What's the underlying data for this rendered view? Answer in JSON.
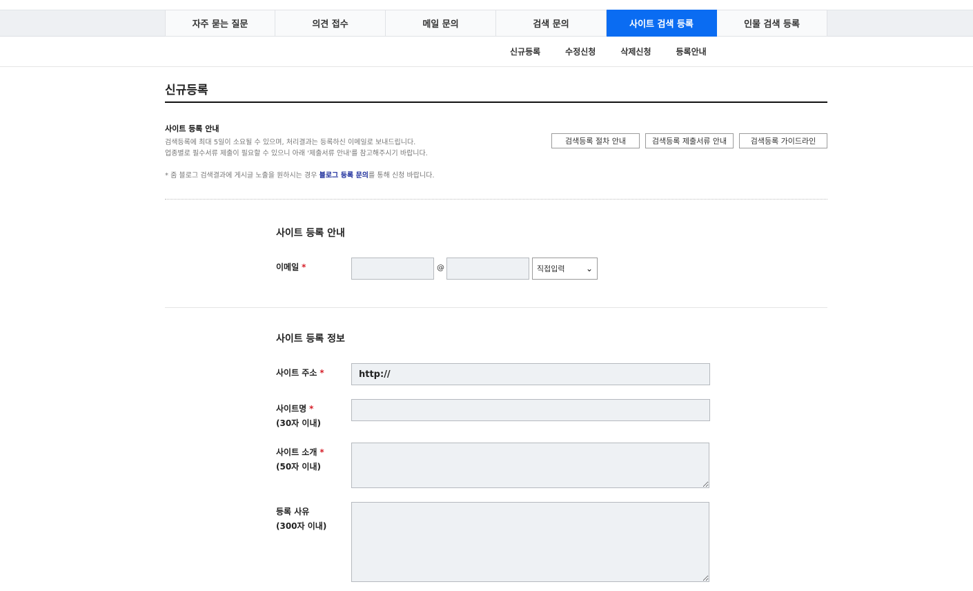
{
  "tabs": [
    {
      "label": "자주 묻는 질문"
    },
    {
      "label": "의견 접수"
    },
    {
      "label": "메일 문의"
    },
    {
      "label": "검색 문의"
    },
    {
      "label": "사이트 검색 등록"
    },
    {
      "label": "인물 검색 등록"
    }
  ],
  "active_tab": "사이트 검색 등록",
  "subnav": [
    "신규등록",
    "수정신청",
    "삭제신청",
    "등록안내"
  ],
  "page_title": "신규등록",
  "guide": {
    "title": "사이트 등록 안내",
    "line1": "검색등록에 최대 5일이 소요될 수 있으며, 처리결과는 등록하신 이메일로 보내드립니다.",
    "line2": "업종별로 필수서류 제출이 필요할 수 있으니 아래 '제출서류 안내'를 참고해주시기 바랍니다.",
    "note_prefix": "* 줌 블로그 검색결과에 게시글 노출을 원하시는 경우 ",
    "note_link": "블로그 등록 문의",
    "note_suffix": "를 통해 신청 바랍니다.",
    "buttons": [
      "검색등록 절차 안내",
      "검색등록 제출서류 안내",
      "검색등록 가이드라인"
    ]
  },
  "section1": {
    "title": "사이트 등록 안내",
    "email_label": "이메일",
    "at_sign": "@",
    "domain_select": "직접입력"
  },
  "section2": {
    "title": "사이트 등록 정보",
    "url_label": "사이트 주소",
    "url_value": "http://",
    "name_label": "사이트명",
    "name_limit": "(30자 이내)",
    "intro_label": "사이트 소개",
    "intro_limit": "(50자 이내)",
    "reason_label": "등록 사유",
    "reason_limit": "(300자 이내)"
  },
  "required_mark": "*",
  "colors": {
    "accent": "#0a6cf2",
    "required": "#d6202a",
    "link": "#1a2b9a",
    "input_bg": "#eef1f4"
  }
}
